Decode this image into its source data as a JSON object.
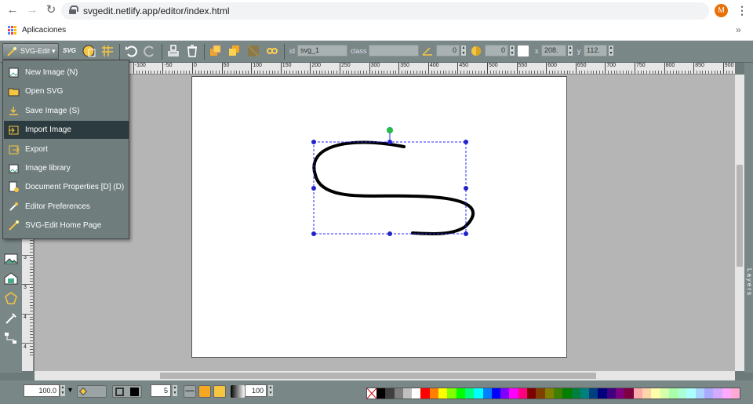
{
  "browser": {
    "url": "svgedit.netlify.app/editor/index.html",
    "bookmarks_label": "Aplicaciones",
    "avatar_letter": "M",
    "more_label": "»"
  },
  "toolbar": {
    "menu_label": "SVG-Edit",
    "id_label": "id",
    "id_value": "svg_1",
    "class_label": "class",
    "class_value": "",
    "angle_value": "0",
    "blur_value": "0",
    "x_label": "x",
    "x_value": "208.",
    "y_label": "y",
    "y_value": "112."
  },
  "menu": {
    "items": [
      {
        "label": "New Image (N)",
        "icon": "new-image-icon"
      },
      {
        "label": "Open SVG",
        "icon": "folder-icon"
      },
      {
        "label": "Save Image (S)",
        "icon": "save-icon"
      },
      {
        "label": "Import Image",
        "icon": "import-icon",
        "active": true
      },
      {
        "label": "Export",
        "icon": "export-icon"
      },
      {
        "label": "Image library",
        "icon": "image-library-icon"
      },
      {
        "label": "Document Properties [D] (D)",
        "icon": "document-properties-icon"
      },
      {
        "label": "Editor Preferences",
        "icon": "preferences-icon"
      },
      {
        "label": "SVG-Edit Home Page",
        "icon": "wand-icon"
      }
    ]
  },
  "ruler": {
    "top_ticks": [
      "-100",
      "-50",
      "0",
      "50",
      "100",
      "150",
      "200",
      "250",
      "300",
      "350",
      "400",
      "450",
      "500",
      "550",
      "600",
      "650",
      "700",
      "750",
      "800",
      "850",
      "900"
    ],
    "left_ticks": [
      "3",
      "3",
      "4",
      "4"
    ]
  },
  "layers_label": "Layers",
  "bottom": {
    "zoom_value": "100.0",
    "stroke_width": "5",
    "opacity_value": "100"
  },
  "palette": [
    "#000000",
    "#3f3f3f",
    "#7f7f7f",
    "#bfbfbf",
    "#ffffff",
    "#ff0000",
    "#ff7f00",
    "#ffff00",
    "#7fff00",
    "#00ff00",
    "#00ff7f",
    "#00ffff",
    "#007fff",
    "#0000ff",
    "#7f00ff",
    "#ff00ff",
    "#ff007f",
    "#7f0000",
    "#7f3f00",
    "#7f7f00",
    "#3f7f00",
    "#007f00",
    "#007f3f",
    "#007f7f",
    "#003f7f",
    "#00007f",
    "#3f007f",
    "#7f007f",
    "#7f003f",
    "#ffaaaa",
    "#ffd4aa",
    "#ffffaa",
    "#d4ffaa",
    "#aaffaa",
    "#aaffd4",
    "#aaffff",
    "#aad4ff",
    "#aaaaff",
    "#d4aaff",
    "#ffaaff",
    "#ffaad4"
  ],
  "accent": "#2c3b3f"
}
